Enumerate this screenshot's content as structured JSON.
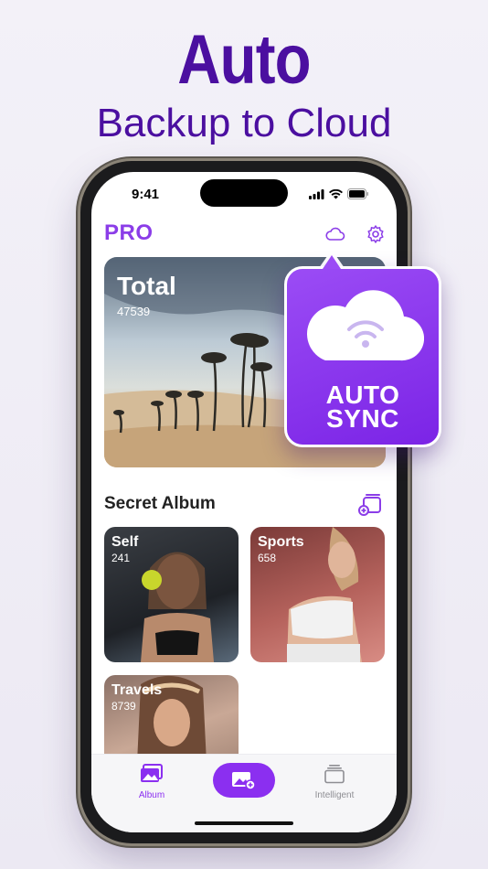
{
  "headline": {
    "title": "Auto",
    "subtitle": "Backup to Cloud"
  },
  "status_bar": {
    "time": "9:41"
  },
  "header": {
    "brand": "PRO",
    "cloud_icon": "cloud-icon",
    "settings_icon": "gear-icon"
  },
  "total_card": {
    "title": "Total",
    "count": "47539"
  },
  "secret_album": {
    "title": "Secret Album",
    "add_icon": "add-album-icon",
    "albums": [
      {
        "name": "Self",
        "count": "241"
      },
      {
        "name": "Sports",
        "count": "658"
      },
      {
        "name": "Travels",
        "count": "8739"
      }
    ]
  },
  "tabbar": {
    "tabs": [
      {
        "label": "Album",
        "icon": "album-icon"
      },
      {
        "label": "",
        "icon": "add-photo-icon"
      },
      {
        "label": "Intelligent",
        "icon": "stack-icon"
      }
    ]
  },
  "popup": {
    "line1": "AUTO",
    "line2": "SYNC",
    "icon": "cloud-wifi-icon"
  },
  "colors": {
    "accent": "#8b2ff0",
    "headline": "#4b0fa0",
    "brand": "#8b3de8"
  }
}
